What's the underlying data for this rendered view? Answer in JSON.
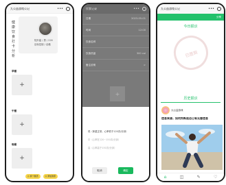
{
  "phone_a": {
    "app_title": "九公益游戏公记",
    "nav_menu": "•••",
    "vertical_text": "健康饮食打卡分析",
    "profile": {
      "name_line": "陆升星 / 男 / 226",
      "id_line": "目标控制 / 合格"
    },
    "sections": [
      {
        "label": "早餐",
        "add": "+"
      },
      {
        "label": "午餐",
        "add": "+"
      },
      {
        "label": "晚餐",
        "add": "+"
      }
    ],
    "actions": [
      "◎ 换个餐谱",
      "◎ 添加我家"
    ]
  },
  "phone_b": {
    "app_title": "饮食记录",
    "nav_menu": "•••",
    "rows": [
      {
        "key": "日期",
        "value": "2023-05-01"
      },
      {
        "key": "时间",
        "value": "12:00"
      },
      {
        "key": "饮食名称",
        "value": ""
      },
      {
        "key": "饮食热量",
        "value": "300 cal"
      },
      {
        "key": "备注说明",
        "value": ">"
      }
    ],
    "add": "+",
    "options": [
      "低（体重正常，心率低于120次/分钟）",
      "中（心率在120~150次/分钟）",
      "高（心率高于150次/分钟）"
    ],
    "cancel": "取消",
    "confirm": "确定"
  },
  "phone_c": {
    "app_title": "九公益游戏公记",
    "nav_menu": "•••",
    "share": "分享",
    "today_title": "今日报识",
    "stamp_text": "已签到",
    "history_title": "历史报识",
    "author_name": "九公益游戏",
    "post_title": "信息来源，如何判断是否已有无害信息",
    "tab_icons": [
      "⌂",
      "◫",
      "✎",
      "♡"
    ]
  },
  "colors": {
    "accent_green": "#23c16b",
    "pill_yellow": "#f5d44a",
    "confirm_green": "#19b95d"
  }
}
